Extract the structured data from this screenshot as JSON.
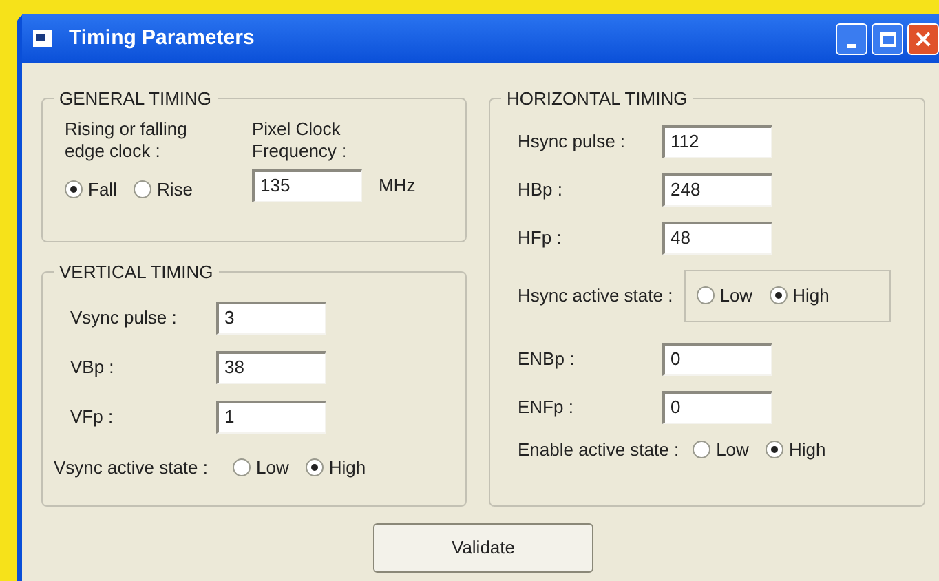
{
  "window": {
    "title": "Timing Parameters"
  },
  "general_timing": {
    "title": "GENERAL TIMING",
    "edge_label": "Rising or falling edge clock :",
    "edge_options": [
      {
        "label": "Fall",
        "selected": true
      },
      {
        "label": "Rise",
        "selected": false
      }
    ],
    "pixel_clock_label": "Pixel Clock Frequency :",
    "pixel_clock_value": "135",
    "unit": "MHz"
  },
  "vertical_timing": {
    "title": "VERTICAL TIMING",
    "fields": [
      {
        "label": "Vsync pulse :",
        "value": "3"
      },
      {
        "label": "VBp :",
        "value": "38"
      },
      {
        "label": "VFp :",
        "value": "1"
      }
    ],
    "active_state": {
      "label": "Vsync active state :",
      "options": [
        {
          "label": "Low",
          "selected": false
        },
        {
          "label": "High",
          "selected": true
        }
      ]
    }
  },
  "horizontal_timing": {
    "title": "HORIZONTAL TIMING",
    "fields": [
      {
        "label": "Hsync pulse :",
        "value": "112"
      },
      {
        "label": "HBp :",
        "value": "248"
      },
      {
        "label": "HFp :",
        "value": "48"
      }
    ],
    "hsync_active_state": {
      "label": "Hsync active state :",
      "options": [
        {
          "label": "Low",
          "selected": false
        },
        {
          "label": "High",
          "selected": true
        }
      ]
    },
    "enable_fields": [
      {
        "label": "ENBp :",
        "value": "0"
      },
      {
        "label": "ENFp :",
        "value": "0"
      }
    ],
    "enable_active_state": {
      "label": "Enable active state :",
      "options": [
        {
          "label": "Low",
          "selected": false
        },
        {
          "label": "High",
          "selected": true
        }
      ]
    }
  },
  "validate_button": "Validate"
}
